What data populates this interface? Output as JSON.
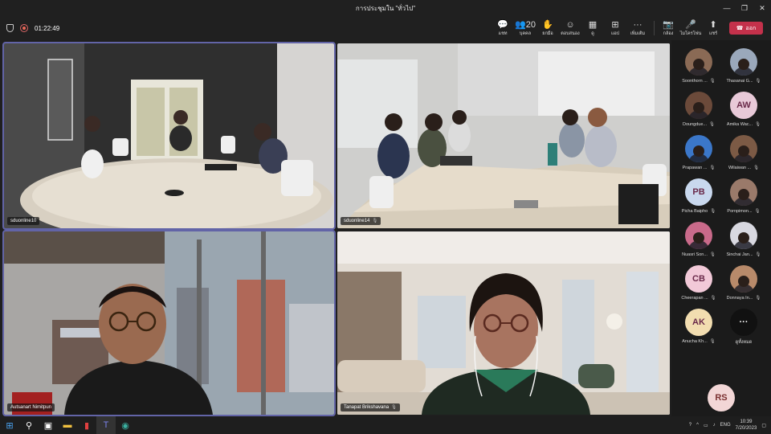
{
  "window": {
    "title": "การประชุมใน \"ทั่วไป\"",
    "minimize": "—",
    "maximize": "❐",
    "close": "✕"
  },
  "toolbar": {
    "timer": "01:22:49",
    "tools": [
      {
        "icon": "💬",
        "label": "แชท",
        "name": "chat"
      },
      {
        "icon": "👥20",
        "label": "บุคคล",
        "name": "people"
      },
      {
        "icon": "✋",
        "label": "ยกมือ",
        "name": "raise-hand"
      },
      {
        "icon": "☺",
        "label": "ตอบสนอง",
        "name": "react"
      },
      {
        "icon": "▦",
        "label": "ดู",
        "name": "view"
      },
      {
        "icon": "⊞",
        "label": "แอป",
        "name": "apps"
      },
      {
        "icon": "···",
        "label": "เพิ่มเติม",
        "name": "more"
      }
    ],
    "devices": [
      {
        "icon": "📷",
        "label": "กล้อง",
        "name": "camera"
      },
      {
        "icon": "🎤",
        "label": "ไมโครโฟน",
        "name": "microphone"
      },
      {
        "icon": "⬆",
        "label": "แชร์",
        "name": "share"
      }
    ],
    "leave_label": "ออก"
  },
  "tiles": [
    {
      "name": "sduonline10",
      "mic": false
    },
    {
      "name": "sduonline14",
      "mic": true
    },
    {
      "name": "Autsanart Nimitpun",
      "mic": false
    },
    {
      "name": "Tanapat Brikshavana",
      "mic": true
    }
  ],
  "participants": [
    {
      "name": "Soonthorn ...",
      "initials": "",
      "bg": "#8a6a55"
    },
    {
      "name": "Thasanai G...",
      "initials": "",
      "bg": "#9aa8bb"
    },
    {
      "name": "Doungdue...",
      "initials": "",
      "bg": "#6b4a3a"
    },
    {
      "name": "Amika Wac...",
      "initials": "AW",
      "bg": "#e8c9d8"
    },
    {
      "name": "Prapawan ...",
      "initials": "",
      "bg": "#3b77c9"
    },
    {
      "name": "Wilaiwan ...",
      "initials": "",
      "bg": "#7c5a45"
    },
    {
      "name": "Picha Baipho",
      "initials": "PB",
      "bg": "#c9d8ee"
    },
    {
      "name": "Pornpimon...",
      "initials": "",
      "bg": "#9a7a6a"
    },
    {
      "name": "Nuasri Son...",
      "initials": "",
      "bg": "#c96a8a"
    },
    {
      "name": "Sinchai Jan...",
      "initials": "",
      "bg": "#d8d8e0"
    },
    {
      "name": "Cheerapan ...",
      "initials": "CB",
      "bg": "#f2c9d8"
    },
    {
      "name": "Donnaya In...",
      "initials": "",
      "bg": "#b88a6a"
    },
    {
      "name": "Anucha Kh...",
      "initials": "AK",
      "bg": "#f2ddb0"
    },
    {
      "name": "ดูทั้งหมด",
      "initials": "···",
      "bg": "#111111"
    }
  ],
  "self_view": {
    "initials": "RS"
  },
  "taskbar": {
    "lang": "ENG",
    "time": "10:39",
    "date": "7/20/2023"
  }
}
